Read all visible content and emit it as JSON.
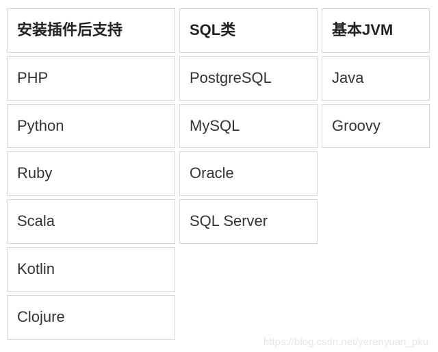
{
  "table": {
    "columns": [
      {
        "header": "安装插件后支持",
        "items": [
          "PHP",
          "Python",
          "Ruby",
          "Scala",
          "Kotlin",
          "Clojure"
        ]
      },
      {
        "header": "SQL类",
        "items": [
          "PostgreSQL",
          "MySQL",
          "Oracle",
          "SQL Server"
        ]
      },
      {
        "header": "基本JVM",
        "items": [
          "Java",
          "Groovy"
        ]
      }
    ]
  },
  "watermark": "https://blog.csdn.net/yerenyuan_pku"
}
